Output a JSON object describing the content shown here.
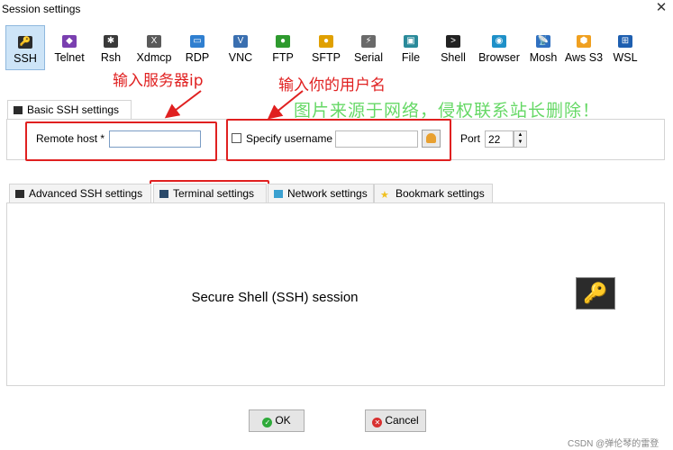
{
  "window": {
    "title": "Session settings",
    "close_glyph": "✕"
  },
  "protocols": [
    {
      "label": "SSH",
      "icon": "ssh-icon",
      "color": "#2b2b2b",
      "glyph": "🔑"
    },
    {
      "label": "Telnet",
      "icon": "telnet-icon",
      "color": "#7a3fb0",
      "glyph": "◆"
    },
    {
      "label": "Rsh",
      "icon": "rsh-icon",
      "color": "#3a3a3a",
      "glyph": "✱"
    },
    {
      "label": "Xdmcp",
      "icon": "xdmcp-icon",
      "color": "#5a5a5a",
      "glyph": "X"
    },
    {
      "label": "RDP",
      "icon": "rdp-icon",
      "color": "#2f7fd0",
      "glyph": "▭"
    },
    {
      "label": "VNC",
      "icon": "vnc-icon",
      "color": "#3a6fb0",
      "glyph": "V"
    },
    {
      "label": "FTP",
      "icon": "ftp-icon",
      "color": "#2e9a2e",
      "glyph": "●"
    },
    {
      "label": "SFTP",
      "icon": "sftp-icon",
      "color": "#e0a000",
      "glyph": "●"
    },
    {
      "label": "Serial",
      "icon": "serial-icon",
      "color": "#6a6a6a",
      "glyph": "⚡"
    },
    {
      "label": "File",
      "icon": "file-icon",
      "color": "#2a8a9a",
      "glyph": "▣"
    },
    {
      "label": "Shell",
      "icon": "shell-icon",
      "color": "#222222",
      "glyph": ">"
    },
    {
      "label": "Browser",
      "icon": "browser-icon",
      "color": "#1e90c8",
      "glyph": "◉"
    },
    {
      "label": "Mosh",
      "icon": "mosh-icon",
      "color": "#3070c0",
      "glyph": "📡"
    },
    {
      "label": "Aws S3",
      "icon": "aws-s3-icon",
      "color": "#f0a020",
      "glyph": "⬢"
    },
    {
      "label": "WSL",
      "icon": "wsl-icon",
      "color": "#1e5fb0",
      "glyph": "⊞"
    }
  ],
  "basic": {
    "tab_label": "Basic SSH settings",
    "remote_host_label": "Remote host *",
    "remote_host_value": "",
    "specify_username_label": "Specify username",
    "username_value": "",
    "port_label": "Port",
    "port_value": "22"
  },
  "annotations": {
    "host_hint": "输入服务器ip",
    "user_hint": "输入你的用户名",
    "watermark": "图片来源于网络，侵权联系站长删除！",
    "credit": "CSDN @弹伦琴的雷登"
  },
  "sub_tabs": [
    {
      "label": "Advanced SSH settings",
      "icon": "advanced-ssh-icon"
    },
    {
      "label": "Terminal settings",
      "icon": "terminal-icon"
    },
    {
      "label": "Network settings",
      "icon": "network-icon"
    },
    {
      "label": "Bookmark settings",
      "icon": "bookmark-star-icon"
    }
  ],
  "session": {
    "caption": "Secure Shell (SSH) session",
    "icon": "key-icon"
  },
  "buttons": {
    "ok": "OK",
    "cancel": "Cancel"
  },
  "colors": {
    "accent_red": "#e02020",
    "watermark_green": "#33cc33",
    "selected_tab": "#cde4f7"
  }
}
